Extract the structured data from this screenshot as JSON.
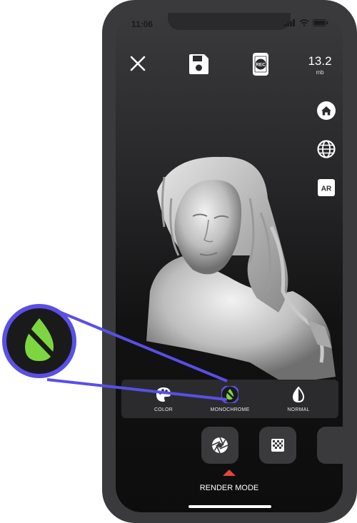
{
  "status_bar": {
    "time": "11:06"
  },
  "top_bar": {
    "close_icon": "close-icon",
    "save_icon": "floppy-disk-icon",
    "rec_icon": "rec-icon",
    "rec_label": "REC",
    "file_size_value": "13.2",
    "file_size_unit": "mb"
  },
  "side_buttons": [
    {
      "icon": "home-icon"
    },
    {
      "icon": "globe-icon"
    },
    {
      "icon": "ar-icon",
      "label": "AR"
    }
  ],
  "render_modes": [
    {
      "label": "COLOR",
      "icon": "palette-icon",
      "selected": false
    },
    {
      "label": "MONOCHROME",
      "icon": "monochrome-icon",
      "selected": true
    },
    {
      "label": "NORMAL",
      "icon": "normal-icon",
      "selected": false
    }
  ],
  "toolbar": {
    "render_mode_label": "RENDER MODE"
  },
  "colors": {
    "accent_green": "#7dd63f",
    "highlight_ring": "#5a4fe6",
    "indicator_red": "#e8423e"
  }
}
